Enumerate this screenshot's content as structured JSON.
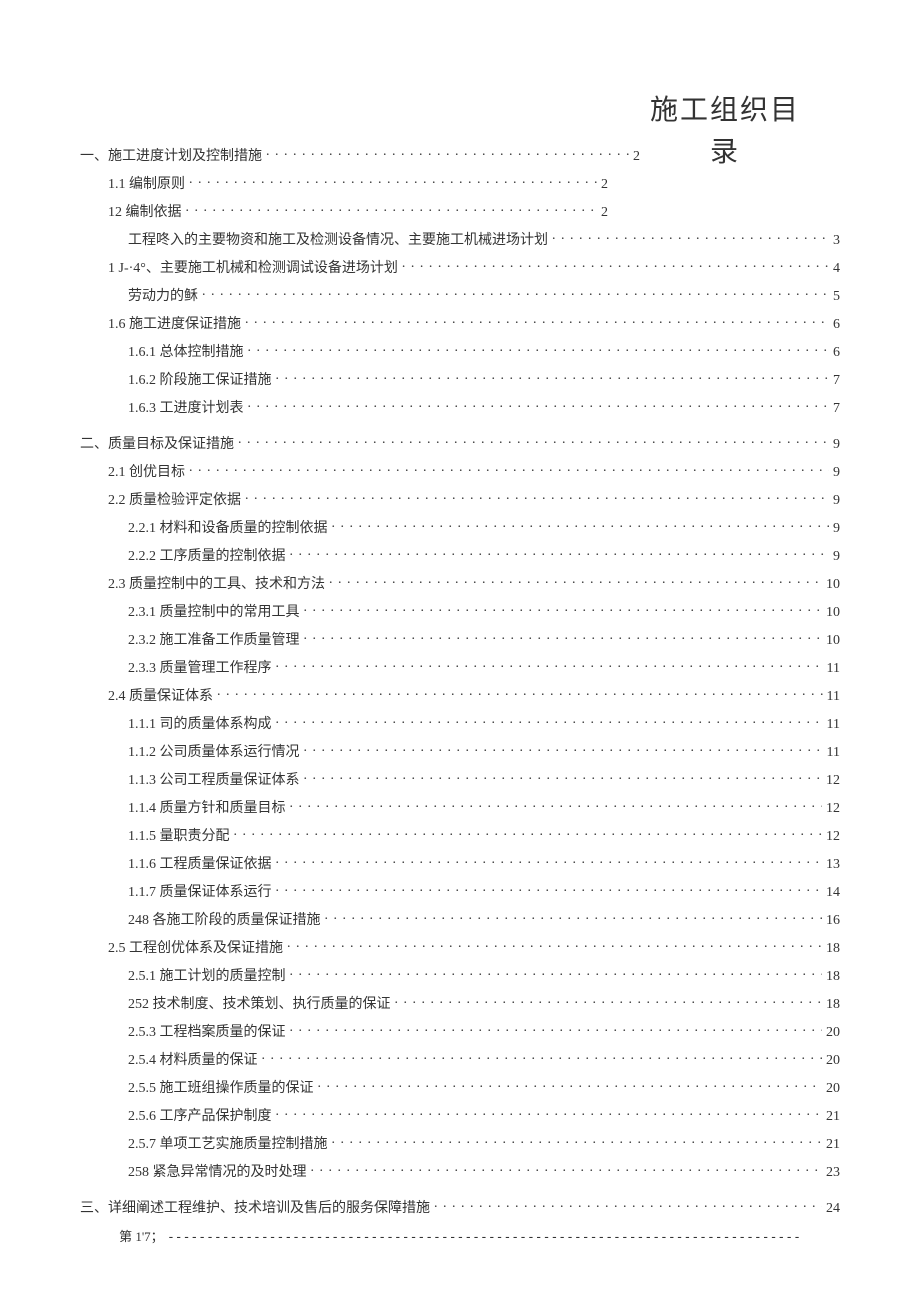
{
  "title_line1": "施工组织目",
  "title_line2": "录",
  "toc": [
    {
      "level": 1,
      "label": "一、施工进度计划及控制措施",
      "page": "2",
      "width_limit": 560
    },
    {
      "level": 2,
      "label": "1.1 编制原则",
      "page": "2",
      "width_limit": 500
    },
    {
      "level": 2,
      "label": "12 编制依据",
      "page": "2",
      "width_limit": 500
    },
    {
      "level": 3,
      "label": "工程咚入的主要物资和施工及检测设备情况、主要施工机械进场计划",
      "page": "3"
    },
    {
      "level": 2,
      "label": "1  J-·4°、主要施工机械和检测调试设备进场计划",
      "page": "4"
    },
    {
      "level": 3,
      "label": "劳动力的稣",
      "page": "5"
    },
    {
      "level": 2,
      "label": "1.6 施工进度保证措施",
      "page": "6"
    },
    {
      "level": 3,
      "label": "1.6.1   总体控制措施",
      "page": "6"
    },
    {
      "level": 3,
      "label": "1.6.2   阶段施工保证措施",
      "page": "7"
    },
    {
      "level": 3,
      "label": "1.6.3     工进度计划表",
      "page": "7"
    },
    {
      "level": 1,
      "label": "二、质量目标及保证措施",
      "page": "9"
    },
    {
      "level": 2,
      "label": "2.1   创优目标",
      "page": "9"
    },
    {
      "level": 2,
      "label": "2.2   质量检验评定依据",
      "page": "9"
    },
    {
      "level": 3,
      "label": "2.2.1   材料和设备质量的控制依据",
      "page": "9"
    },
    {
      "level": 3,
      "label": "2.2.2   工序质量的控制依据",
      "page": "9"
    },
    {
      "level": 2,
      "label": "2.3   质量控制中的工具、技术和方法",
      "page": "10"
    },
    {
      "level": 3,
      "label": "2.3.1   质量控制中的常用工具",
      "page": "10"
    },
    {
      "level": 3,
      "label": "2.3.2   施工准备工作质量管理",
      "page": "10"
    },
    {
      "level": 3,
      "label": "2.3.3   质量管理工作程序",
      "page": "11"
    },
    {
      "level": 2,
      "label": "2.4   质量保证体系",
      "page": "11"
    },
    {
      "level": 3,
      "label": "1.1.1       司的质量体系构成",
      "page": "11"
    },
    {
      "level": 3,
      "label": "1.1.2   公司质量体系运行情况",
      "page": "11"
    },
    {
      "level": 3,
      "label": "1.1.3   公司工程质量保证体系",
      "page": "12"
    },
    {
      "level": 3,
      "label": "1.1.4   质量方针和质量目标",
      "page": "12"
    },
    {
      "level": 3,
      "label": "1.1.5      量职责分配",
      "page": "12"
    },
    {
      "level": 3,
      "label": "1.1.6   工程质量保证依据",
      "page": "13"
    },
    {
      "level": 3,
      "label": "1.1.7   质量保证体系运行",
      "page": "14"
    },
    {
      "level": 3,
      "label": "248 各施工阶段的质量保证措施",
      "page": "16"
    },
    {
      "level": 2,
      "label": "2.5 工程创优体系及保证措施",
      "page": "18"
    },
    {
      "level": 3,
      "label": "2.5.1   施工计划的质量控制",
      "page": "18"
    },
    {
      "level": 3,
      "label": "252 技术制度、技术策划、执行质量的保证",
      "page": "18"
    },
    {
      "level": 3,
      "label": "2.5.3   工程档案质量的保证",
      "page": "20"
    },
    {
      "level": 3,
      "label": "2.5.4   材料质量的保证",
      "page": "20"
    },
    {
      "level": 3,
      "label": "2.5.5   施工班组操作质量的保证",
      "page": "20"
    },
    {
      "level": 3,
      "label": "2.5.6   工序产品保护制度",
      "page": "21"
    },
    {
      "level": 3,
      "label": "2.5.7   单项工艺实施质量控制措施",
      "page": "21"
    },
    {
      "level": 3,
      "label": "258 紧急异常情况的及时处理",
      "page": "23"
    },
    {
      "level": 1,
      "label": "三、详细阐述工程维护、技术培训及售后的服务保障措施",
      "page": "24"
    }
  ],
  "footer_label": "第 1'7；",
  "footer_dash": "---------------------------------------------------------------------------------"
}
